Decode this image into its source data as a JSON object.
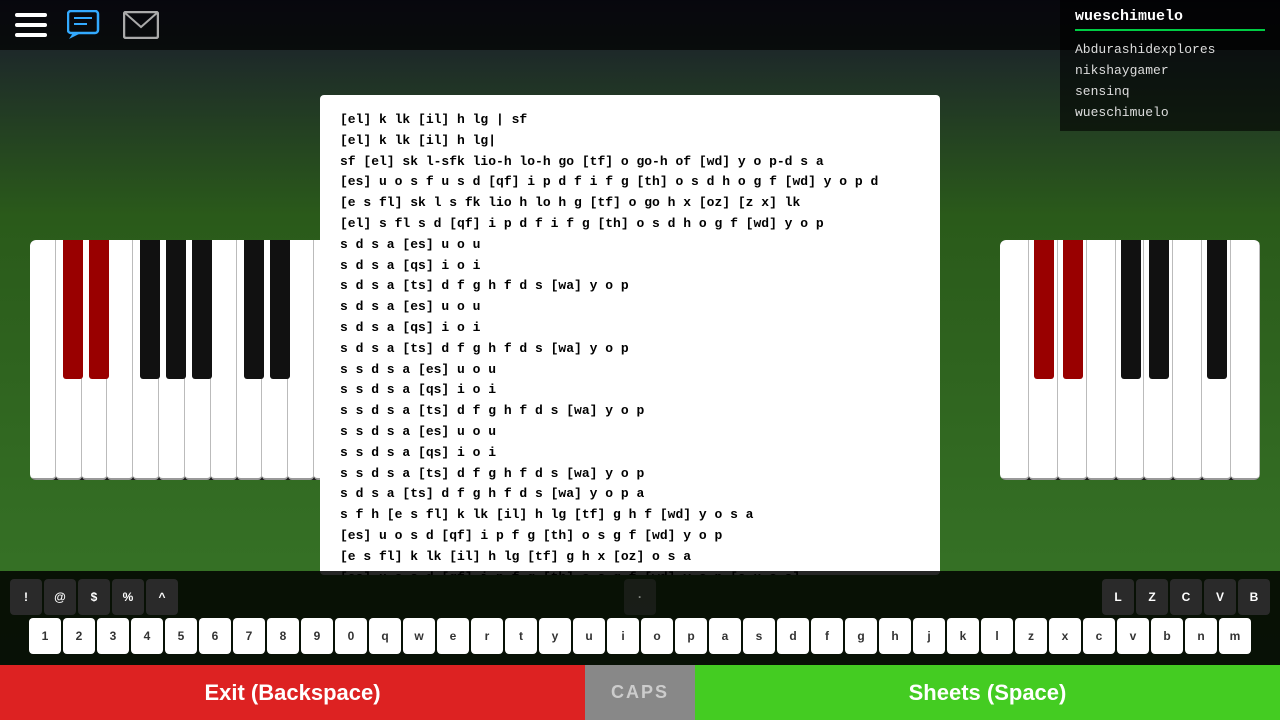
{
  "topbar": {
    "hamburger_label": "menu",
    "chat_label": "chat",
    "mail_label": "mail"
  },
  "player_list": {
    "current_user": "wueschimuelo",
    "players": [
      "Abdurashidexplores",
      "nikshaygamer",
      "sensinq",
      "wueschimuelo"
    ]
  },
  "sheet": {
    "content": "[el] k lk [il] h lg | sf\n[el] k lk [il] h lg|\nsf [el] sk l-sfk lio-h lo-h go [tf] o go-h of [wd] y o p-d s a\n[es] u o s f u s d [qf] i p d f i f g [th] o s d h o g f [wd] y o p d\n[e s fl] sk l s fk lio h lo h g [tf] o go h x [oz] [z x] lk\n[el] s fl s d [qf] i p d f i f g [th] o s d h o g f [wd] y o p\ns d s a [es] u o u\ns d s a [qs] i o i\ns d s a [ts] d f g h f d s [wa] y o p\ns d s a [es] u o u\ns d s a [qs] i o i\ns d s a [ts] d f g h f d s [wa] y o p\ns s d s a [es] u o u\ns s d s a [qs] i o i\ns s d s a [ts] d f g h f d s [wa] y o p\ns s d s a [es] u o u\ns s d s a [qs] i o i\ns s d s a [ts] d f g h f d s [wa] y o p\ns d s a [ts] d f g h f d s [wa] y o p a\ns f h [e s fl] k lk [il] h lg [tf] g h f [wd] y o s a\n[es] u o s d [qf] i p f g [th] o s g f [wd] y o p\n[e s fl] k lk [il] h lg [tf] g h x [oz] o s a\n[es] u o s d [qf] i p f g [th] o s g f [wd] y o p [e u o s]"
  },
  "keyboard": {
    "special_row_left": [
      "!",
      "@",
      "$",
      "%",
      "^"
    ],
    "special_row_right": [
      "L",
      "Z",
      "C",
      "V",
      "B"
    ],
    "main_row": [
      "1",
      "2",
      "3",
      "4",
      "5",
      "6",
      "7",
      "8",
      "9",
      "0",
      "q",
      "w",
      "e",
      "r",
      "t",
      "y",
      "u",
      "i",
      "o",
      "p",
      "a",
      "s",
      "d",
      "f",
      "g",
      "h",
      "j",
      "k",
      "l",
      "z",
      "x",
      "c",
      "v",
      "b",
      "n",
      "m"
    ]
  },
  "buttons": {
    "exit_label": "Exit (Backspace)",
    "caps_label": "CAPS",
    "sheets_label": "Sheets (Space)"
  },
  "colors": {
    "exit_bg": "#dd2222",
    "caps_bg": "#888888",
    "sheets_bg": "#44cc22",
    "accent_green": "#00cc44"
  }
}
